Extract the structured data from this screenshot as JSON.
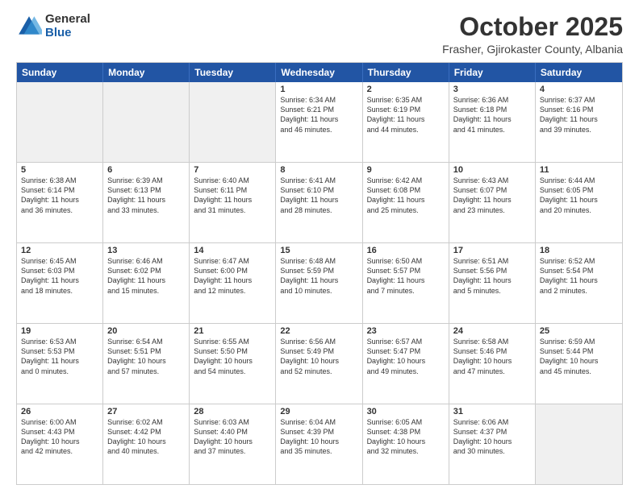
{
  "header": {
    "logo": {
      "general": "General",
      "blue": "Blue"
    },
    "title": "October 2025",
    "location": "Frasher, Gjirokaster County, Albania"
  },
  "dayHeaders": [
    "Sunday",
    "Monday",
    "Tuesday",
    "Wednesday",
    "Thursday",
    "Friday",
    "Saturday"
  ],
  "weeks": [
    [
      {
        "num": "",
        "info": ""
      },
      {
        "num": "",
        "info": ""
      },
      {
        "num": "",
        "info": ""
      },
      {
        "num": "1",
        "info": "Sunrise: 6:34 AM\nSunset: 6:21 PM\nDaylight: 11 hours\nand 46 minutes."
      },
      {
        "num": "2",
        "info": "Sunrise: 6:35 AM\nSunset: 6:19 PM\nDaylight: 11 hours\nand 44 minutes."
      },
      {
        "num": "3",
        "info": "Sunrise: 6:36 AM\nSunset: 6:18 PM\nDaylight: 11 hours\nand 41 minutes."
      },
      {
        "num": "4",
        "info": "Sunrise: 6:37 AM\nSunset: 6:16 PM\nDaylight: 11 hours\nand 39 minutes."
      }
    ],
    [
      {
        "num": "5",
        "info": "Sunrise: 6:38 AM\nSunset: 6:14 PM\nDaylight: 11 hours\nand 36 minutes."
      },
      {
        "num": "6",
        "info": "Sunrise: 6:39 AM\nSunset: 6:13 PM\nDaylight: 11 hours\nand 33 minutes."
      },
      {
        "num": "7",
        "info": "Sunrise: 6:40 AM\nSunset: 6:11 PM\nDaylight: 11 hours\nand 31 minutes."
      },
      {
        "num": "8",
        "info": "Sunrise: 6:41 AM\nSunset: 6:10 PM\nDaylight: 11 hours\nand 28 minutes."
      },
      {
        "num": "9",
        "info": "Sunrise: 6:42 AM\nSunset: 6:08 PM\nDaylight: 11 hours\nand 25 minutes."
      },
      {
        "num": "10",
        "info": "Sunrise: 6:43 AM\nSunset: 6:07 PM\nDaylight: 11 hours\nand 23 minutes."
      },
      {
        "num": "11",
        "info": "Sunrise: 6:44 AM\nSunset: 6:05 PM\nDaylight: 11 hours\nand 20 minutes."
      }
    ],
    [
      {
        "num": "12",
        "info": "Sunrise: 6:45 AM\nSunset: 6:03 PM\nDaylight: 11 hours\nand 18 minutes."
      },
      {
        "num": "13",
        "info": "Sunrise: 6:46 AM\nSunset: 6:02 PM\nDaylight: 11 hours\nand 15 minutes."
      },
      {
        "num": "14",
        "info": "Sunrise: 6:47 AM\nSunset: 6:00 PM\nDaylight: 11 hours\nand 12 minutes."
      },
      {
        "num": "15",
        "info": "Sunrise: 6:48 AM\nSunset: 5:59 PM\nDaylight: 11 hours\nand 10 minutes."
      },
      {
        "num": "16",
        "info": "Sunrise: 6:50 AM\nSunset: 5:57 PM\nDaylight: 11 hours\nand 7 minutes."
      },
      {
        "num": "17",
        "info": "Sunrise: 6:51 AM\nSunset: 5:56 PM\nDaylight: 11 hours\nand 5 minutes."
      },
      {
        "num": "18",
        "info": "Sunrise: 6:52 AM\nSunset: 5:54 PM\nDaylight: 11 hours\nand 2 minutes."
      }
    ],
    [
      {
        "num": "19",
        "info": "Sunrise: 6:53 AM\nSunset: 5:53 PM\nDaylight: 11 hours\nand 0 minutes."
      },
      {
        "num": "20",
        "info": "Sunrise: 6:54 AM\nSunset: 5:51 PM\nDaylight: 10 hours\nand 57 minutes."
      },
      {
        "num": "21",
        "info": "Sunrise: 6:55 AM\nSunset: 5:50 PM\nDaylight: 10 hours\nand 54 minutes."
      },
      {
        "num": "22",
        "info": "Sunrise: 6:56 AM\nSunset: 5:49 PM\nDaylight: 10 hours\nand 52 minutes."
      },
      {
        "num": "23",
        "info": "Sunrise: 6:57 AM\nSunset: 5:47 PM\nDaylight: 10 hours\nand 49 minutes."
      },
      {
        "num": "24",
        "info": "Sunrise: 6:58 AM\nSunset: 5:46 PM\nDaylight: 10 hours\nand 47 minutes."
      },
      {
        "num": "25",
        "info": "Sunrise: 6:59 AM\nSunset: 5:44 PM\nDaylight: 10 hours\nand 45 minutes."
      }
    ],
    [
      {
        "num": "26",
        "info": "Sunrise: 6:00 AM\nSunset: 4:43 PM\nDaylight: 10 hours\nand 42 minutes."
      },
      {
        "num": "27",
        "info": "Sunrise: 6:02 AM\nSunset: 4:42 PM\nDaylight: 10 hours\nand 40 minutes."
      },
      {
        "num": "28",
        "info": "Sunrise: 6:03 AM\nSunset: 4:40 PM\nDaylight: 10 hours\nand 37 minutes."
      },
      {
        "num": "29",
        "info": "Sunrise: 6:04 AM\nSunset: 4:39 PM\nDaylight: 10 hours\nand 35 minutes."
      },
      {
        "num": "30",
        "info": "Sunrise: 6:05 AM\nSunset: 4:38 PM\nDaylight: 10 hours\nand 32 minutes."
      },
      {
        "num": "31",
        "info": "Sunrise: 6:06 AM\nSunset: 4:37 PM\nDaylight: 10 hours\nand 30 minutes."
      },
      {
        "num": "",
        "info": ""
      }
    ]
  ]
}
